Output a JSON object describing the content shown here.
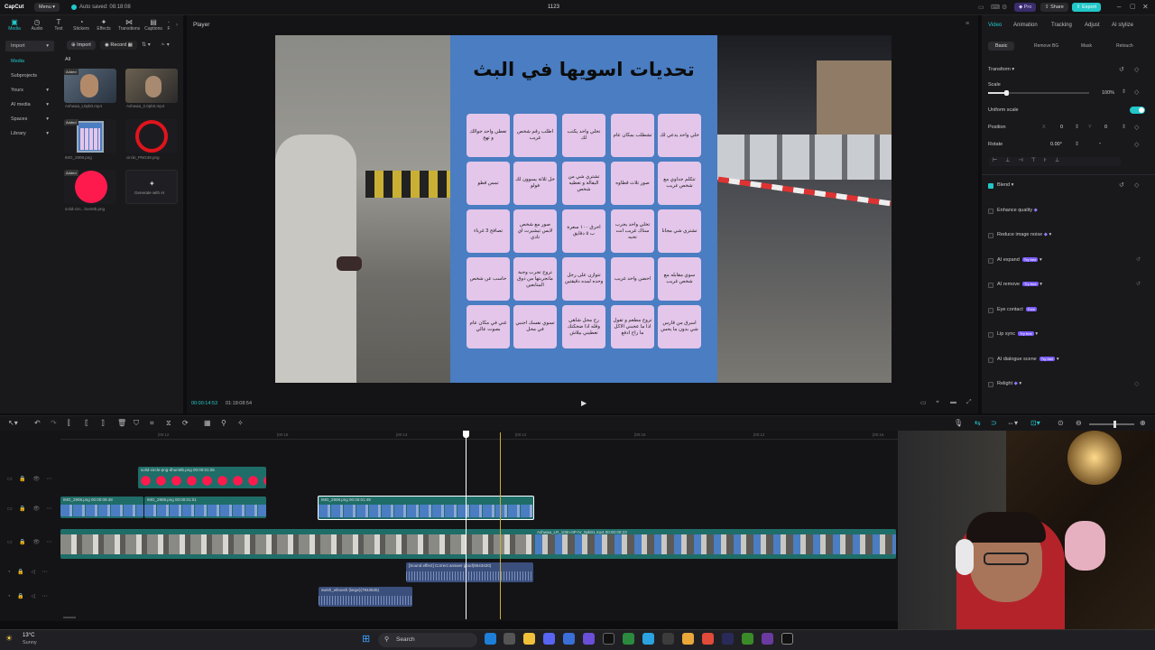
{
  "app": {
    "name": "CapCut",
    "menu_label": "Menu",
    "autosave": "Auto saved: 08:18:08",
    "project_title": "1123",
    "pro_label": "Pro",
    "share_label": "Share",
    "export_label": "Export"
  },
  "toolbar": {
    "items": [
      "Media",
      "Audio",
      "Text",
      "Stickers",
      "Effects",
      "Transitions",
      "Captions",
      "F"
    ]
  },
  "media_panel": {
    "import_label": "Import",
    "import_btn": "Import",
    "record_btn": "Record",
    "filter_all": "All",
    "side_items": [
      "Media",
      "Subprojects",
      "Yours",
      "AI media",
      "Spaces",
      "Library"
    ],
    "items": [
      {
        "caption": "Ashwaa_L0pb0.mp4",
        "added": "Added"
      },
      {
        "caption": "Ashwaa_2.0pb0.mp4",
        "added": ""
      },
      {
        "caption": "IMG_2908.png",
        "added": "Added"
      },
      {
        "caption": "circle_PNG49.png",
        "added": ""
      },
      {
        "caption": "solid-circ...hum8b.png",
        "added": "Added"
      },
      {
        "caption": "Generate with AI",
        "added": ""
      }
    ]
  },
  "player": {
    "title": "Player",
    "current_time": "00:00:14:53",
    "total_time": "01:18:08:54",
    "poster_title": "تحديات اسويها في البث",
    "cells": [
      "خلي واحد يدعي لك",
      "تشطلب بمكان عام",
      "تخلي واحد يكتب لك",
      "اطلب رقم شخص غريب",
      "تعطي واحد جوالك و تهج",
      "تتكلم جداوي مع شخص غريب",
      "صور تلاث قطاوه",
      "تشتري شي من البقالة و تعطيه شخص",
      "خل ثلاثة يسوون لك فولو",
      "تمس قطو",
      "تشتري شي مجانا",
      "تخلي واحد يجرب سناك غريب انت تحبه",
      "احرق ١٠٠ سعرة ب ٥ دقايق",
      "صور مع شخص لابس تيشيرت اي نادي",
      "تصافح 3 غرباء",
      "سوي مقابله مع شخص غريب",
      "احضن واحد غريب",
      "تتوازن على رجل وحده لمده دقيقتين",
      "تروح تجرب وجبة مانجربتها من ذوق المتابعين",
      "حاسب عن شخص",
      "اسرق من قارس شي بدون ما يحس",
      "تروح مطعم و تقول اذا ما عجبني الاكل ما راح ادفع",
      "رح محل شاهي وقله اذا ضحكتك تعطيني بيلاش",
      "تسوي نفسك اجنبي في محل",
      "غني في مكان عام بصوت عالي"
    ]
  },
  "inspector": {
    "tabs": [
      "Video",
      "Animation",
      "Tracking",
      "Adjust",
      "AI stylize"
    ],
    "subtabs": [
      "Basic",
      "Remove BG",
      "Mask",
      "Retouch"
    ],
    "transform_label": "Transform",
    "scale_label": "Scale",
    "scale_value": "100%",
    "scale_fraction": 0.18,
    "uniform_scale_label": "Uniform scale",
    "position_label": "Position",
    "pos_x_label": "X",
    "pos_x": "0",
    "pos_y_label": "Y",
    "pos_y": "0",
    "rotate_label": "Rotate",
    "rotate_value": "0.00°",
    "rotate_dash": "-",
    "blend_label": "Blend",
    "enhance_quality": "Enhance quality",
    "reduce_noise": "Reduce image noise",
    "ai_expand": "AI expand",
    "ai_remove": "AI remove",
    "eye_contact": "Eye contact",
    "lip_sync": "Lip sync",
    "ai_dialogue": "AI dialogue scene",
    "relight": "Relight",
    "try_new": "Try free",
    "free": "Free"
  },
  "timeline": {
    "ruler": [
      "|00:12",
      "|00:16",
      "|00:14",
      "|00:12",
      "|00:16",
      "|00:12",
      "|00:16"
    ],
    "clips": {
      "sticker": "solid-circle-png-dhum8b.png  00:00:01:05",
      "img1": "IMG_2908.png  00:00:09:48",
      "img2": "IMG_2908.png  00:00:01:01",
      "img3": "IMG_2908.png  00:00:01:49",
      "video1": "Ashwaa_LR_100n-0P-IV_0pb01.mp4  00:00:00:23",
      "sfx1": "[Sound effect] Correct answer good(9543420)",
      "sfx2": "swish_whoosh (large)(7843535)"
    }
  },
  "taskbar": {
    "temp": "13°C",
    "weather": "Sunny",
    "search_placeholder": "Search"
  },
  "colors": {
    "accent": "#22c7c9",
    "pro": "#3a2d6b",
    "poster_bg": "#4a7dc2",
    "cell_bg": "#e4c6ea",
    "clip_teal": "#1f6d68",
    "audio_blue": "#3b4f7d"
  }
}
